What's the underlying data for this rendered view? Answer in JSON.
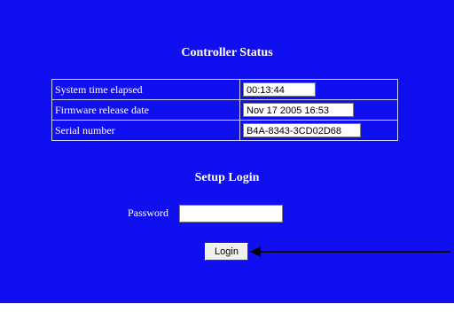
{
  "status": {
    "title": "Controller Status",
    "rows": [
      {
        "label": "System time elapsed",
        "value": "00:13:44"
      },
      {
        "label": "Firmware release date",
        "value": "Nov 17 2005 16:53"
      },
      {
        "label": "Serial number",
        "value": "B4A-8343-3CD02D68"
      }
    ]
  },
  "login": {
    "title": "Setup Login",
    "password_label": "Password",
    "password_value": "",
    "button_label": "Login"
  },
  "colors": {
    "background": "#0f0fef",
    "text": "#ffffff",
    "annotation_arrow": "#000000"
  },
  "icons": {
    "annotation": "arrow-left-icon"
  }
}
